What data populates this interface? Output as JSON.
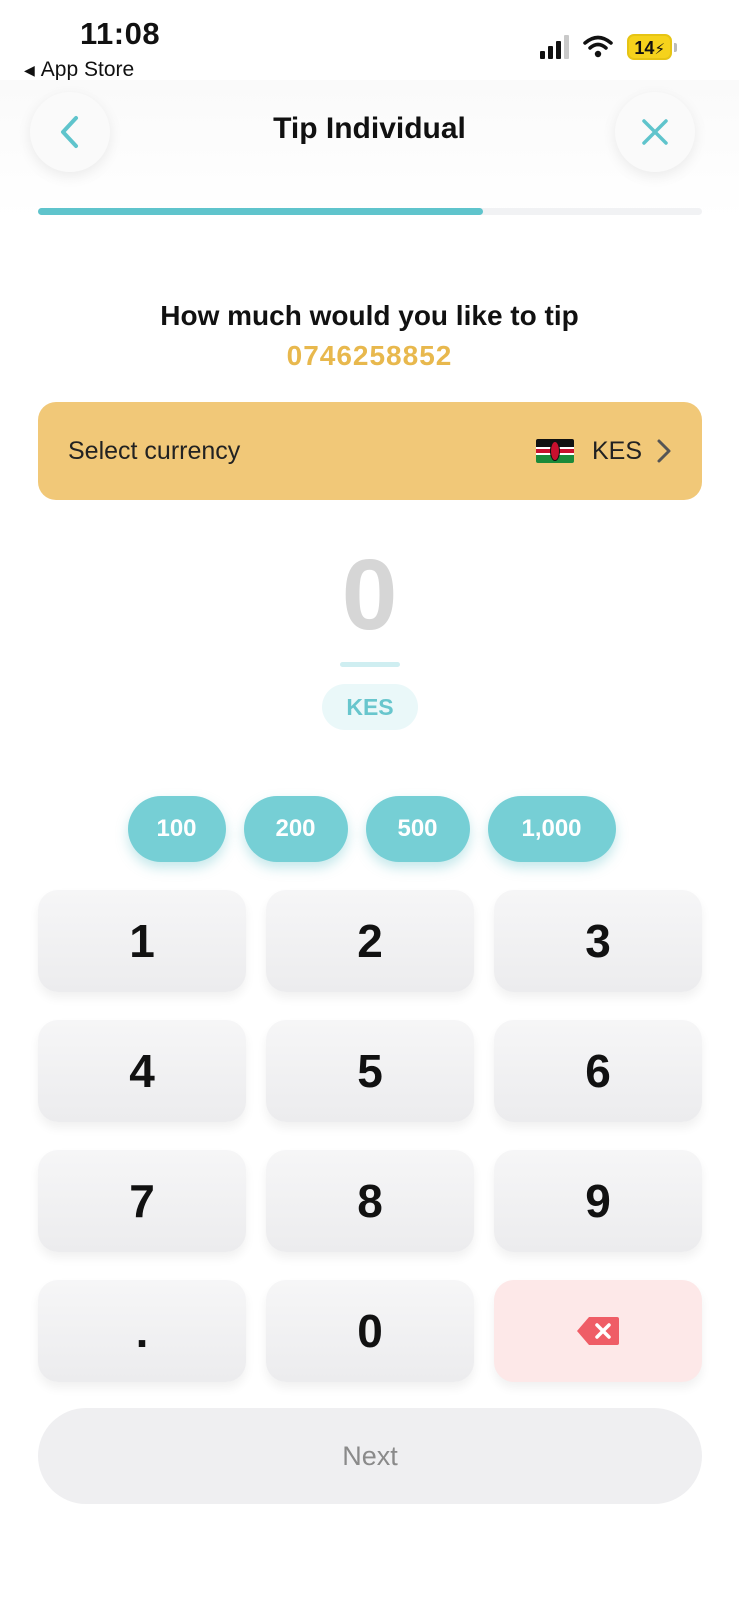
{
  "status_bar": {
    "time": "11:08",
    "back_app": "App Store",
    "battery": "14"
  },
  "header": {
    "title": "Tip Individual",
    "back_icon": "chevron-left-icon",
    "close_icon": "close-icon",
    "accent_color": "#5fc4cc"
  },
  "progress": {
    "value": 0.67
  },
  "prompt": {
    "question": "How much would you like to tip",
    "recipient": "0746258852",
    "recipient_color": "#e8b84d"
  },
  "currency": {
    "label": "Select currency",
    "code": "KES",
    "flag_icon": "kenya-flag-icon",
    "background": "#f1c878"
  },
  "amount": {
    "value": "0",
    "unit": "KES"
  },
  "presets": [
    "100",
    "200",
    "500",
    "1,000"
  ],
  "keypad": {
    "keys": [
      "1",
      "2",
      "3",
      "4",
      "5",
      "6",
      "7",
      "8",
      "9",
      ".",
      "0"
    ],
    "delete_icon": "backspace-icon"
  },
  "next_button": {
    "label": "Next"
  }
}
